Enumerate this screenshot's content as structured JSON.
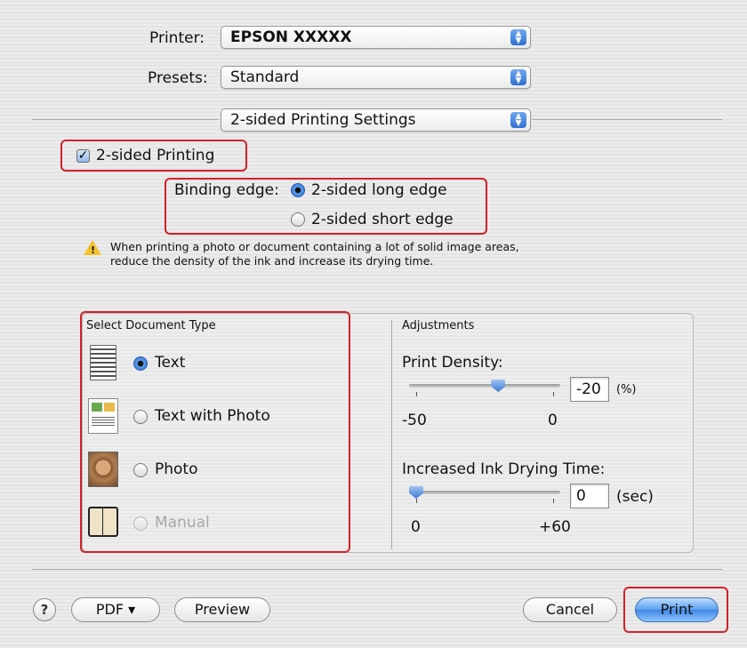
{
  "printer": {
    "label": "Printer:",
    "value": "EPSON XXXXX"
  },
  "presets": {
    "label": "Presets:",
    "value": "Standard"
  },
  "panel_menu": {
    "value": "2-sided Printing Settings"
  },
  "two_sided": {
    "label": "2-sided Printing",
    "checked": true
  },
  "binding": {
    "label": "Binding edge:",
    "options": [
      "2-sided long edge",
      "2-sided short edge"
    ],
    "selected": "2-sided long edge"
  },
  "warning": {
    "line1": "When printing a photo or document containing a lot of solid image areas,",
    "line2": "reduce the density of the ink and increase its drying time."
  },
  "doc_type": {
    "title": "Select Document Type",
    "options": [
      "Text",
      "Text with Photo",
      "Photo",
      "Manual"
    ],
    "selected": "Text"
  },
  "adjustments": {
    "title": "Adjustments",
    "density": {
      "label": "Print Density:",
      "value": "-20",
      "unit": "(%)",
      "min": "-50",
      "max": "0",
      "slider_fraction": 0.6
    },
    "drying": {
      "label": "Increased Ink Drying Time:",
      "value": "0",
      "unit": "(sec)",
      "min": "0",
      "max": "+60",
      "slider_fraction": 0.0
    }
  },
  "footer": {
    "help": "?",
    "pdf": "PDF ▾",
    "preview": "Preview",
    "cancel": "Cancel",
    "print": "Print"
  },
  "colors": {
    "accent": "#2f6fd4",
    "highlight": "#d4202a",
    "warning": "#f2c22a"
  }
}
